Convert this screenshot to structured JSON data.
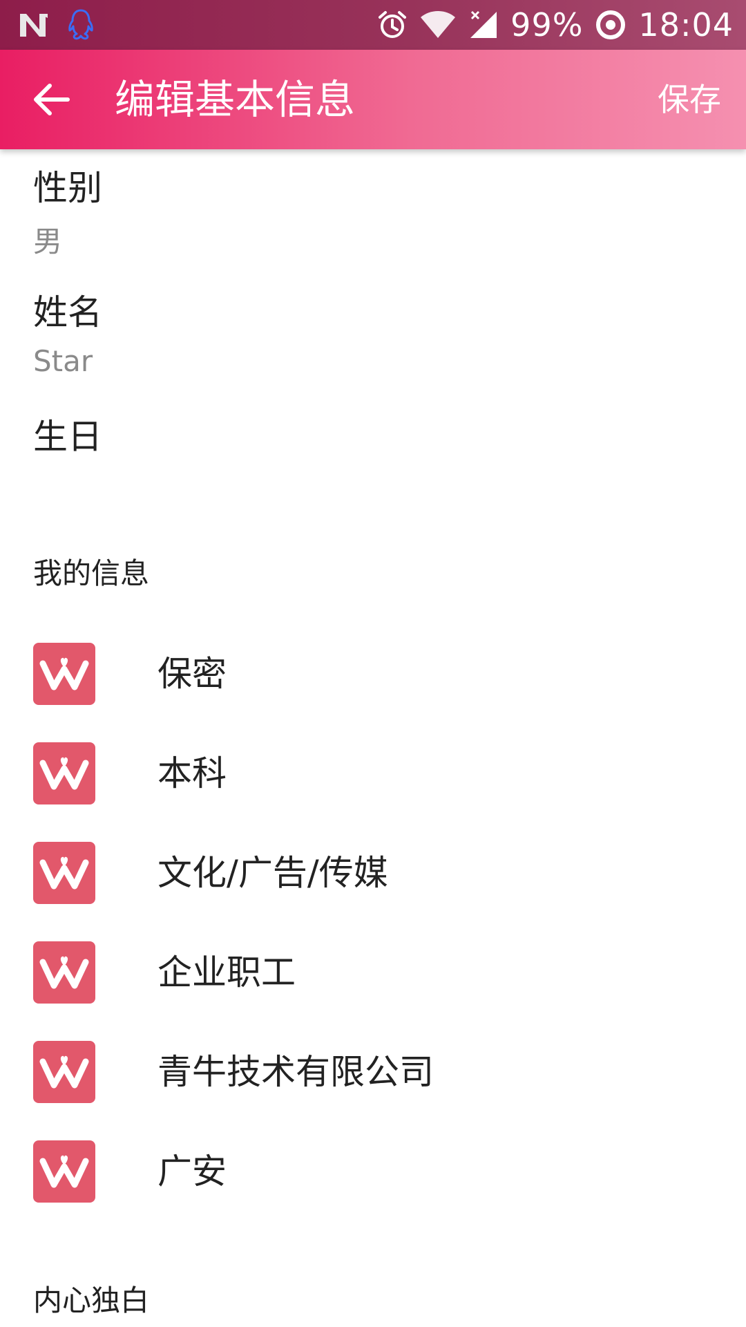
{
  "status_bar": {
    "left_icons": [
      "n-notification-icon",
      "qq-icon"
    ],
    "right_icons": [
      "alarm-icon",
      "wifi-icon",
      "cell-signal-icon"
    ],
    "battery": "99%",
    "time": "18:04"
  },
  "app_bar": {
    "back_icon": "arrow-left-icon",
    "title": "编辑基本信息",
    "save_label": "保存"
  },
  "basic_fields": [
    {
      "label": "性别",
      "value": "男"
    },
    {
      "label": "姓名",
      "value": "Star"
    },
    {
      "label": "生日",
      "value": ""
    }
  ],
  "my_info": {
    "header": "我的信息",
    "items": [
      {
        "icon": "w-heart-logo-icon",
        "text": "保密"
      },
      {
        "icon": "w-heart-logo-icon",
        "text": "本科"
      },
      {
        "icon": "w-heart-logo-icon",
        "text": "文化/广告/传媒"
      },
      {
        "icon": "w-heart-logo-icon",
        "text": "企业职工"
      },
      {
        "icon": "w-heart-logo-icon",
        "text": "青牛技术有限公司"
      },
      {
        "icon": "w-heart-logo-icon",
        "text": "广安"
      }
    ]
  },
  "monologue": {
    "header": "内心独白"
  },
  "colors": {
    "status_bar": "#8e1d4a",
    "app_bar_start": "#e91e63",
    "app_bar_end": "#f590b0",
    "icon_bg": "#e2586b"
  }
}
